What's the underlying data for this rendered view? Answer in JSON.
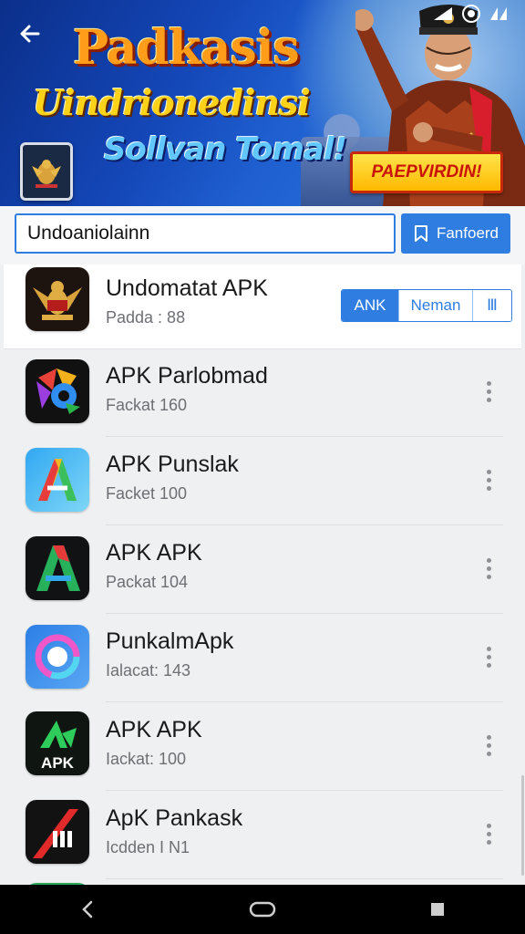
{
  "banner": {
    "title": "Padkasis",
    "subtitle": "Uindrionedinsi",
    "tagline": "Sollvan Tomal!",
    "badge": "PAEPVIRDIN!"
  },
  "search": {
    "value": "Undoaniolainn",
    "button_label": "Fanfoerd"
  },
  "featured": {
    "name": "Undomatat APK",
    "meta": "Padda : 88",
    "segments": [
      "ANK",
      "Neman",
      "Ⅲ"
    ]
  },
  "apps": [
    {
      "name": "APK Parlobmad",
      "meta": "Fackat 160",
      "icon": "colorful-maps-icon"
    },
    {
      "name": "APK Punslak",
      "meta": "Facket 100",
      "icon": "gradient-a-icon"
    },
    {
      "name": "APK APK",
      "meta": "Packat 104",
      "icon": "dark-a-icon"
    },
    {
      "name": "PunkalmApk",
      "meta": "Ialacat: 143",
      "icon": "ring-icon"
    },
    {
      "name": "APK APK",
      "meta": "Iackat: 100",
      "icon": "apk-logo-icon"
    },
    {
      "name": "ApK Pankask",
      "meta": "Icdden I N1",
      "icon": "red-slash-icon"
    }
  ],
  "colors": {
    "accent": "#2f7de1",
    "banner_blue": "#1447b8",
    "promo_yellow": "#ffd21a"
  }
}
